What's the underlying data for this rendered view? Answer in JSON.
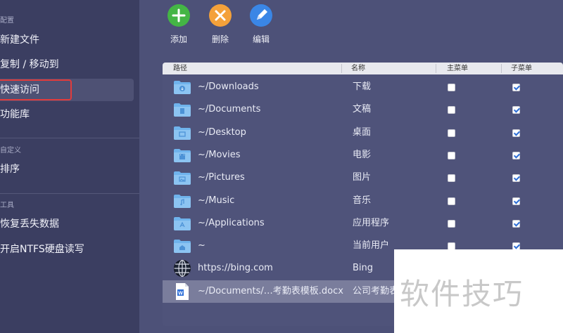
{
  "sidebar": {
    "sections": [
      {
        "label": "配置",
        "items": [
          "新建文件",
          "复制 / 移动到",
          "快速访问",
          "功能库"
        ]
      },
      {
        "label": "自定义",
        "items": [
          "排序"
        ]
      },
      {
        "label": "工具",
        "items": [
          "恢复丢失数据",
          "开启NTFS硬盘读写"
        ]
      }
    ],
    "selected": "快速访问"
  },
  "toolbar": {
    "add_label": "添加",
    "delete_label": "删除",
    "edit_label": "编辑"
  },
  "table": {
    "columns": [
      "路径",
      "名称",
      "主菜单",
      "子菜单"
    ],
    "rows": [
      {
        "icon": "downloads-folder-icon",
        "path": "~/Downloads",
        "name": "下载",
        "main": false,
        "sub": true
      },
      {
        "icon": "documents-folder-icon",
        "path": "~/Documents",
        "name": "文稿",
        "main": false,
        "sub": true
      },
      {
        "icon": "desktop-folder-icon",
        "path": "~/Desktop",
        "name": "桌面",
        "main": false,
        "sub": true
      },
      {
        "icon": "movies-folder-icon",
        "path": "~/Movies",
        "name": "电影",
        "main": false,
        "sub": true
      },
      {
        "icon": "pictures-folder-icon",
        "path": "~/Pictures",
        "name": "图片",
        "main": false,
        "sub": true
      },
      {
        "icon": "music-folder-icon",
        "path": "~/Music",
        "name": "音乐",
        "main": false,
        "sub": true
      },
      {
        "icon": "applications-folder-icon",
        "path": "~/Applications",
        "name": "应用程序",
        "main": false,
        "sub": true
      },
      {
        "icon": "home-folder-icon",
        "path": "~",
        "name": "当前用户",
        "main": false,
        "sub": true
      },
      {
        "icon": "globe-icon",
        "path": "https://bing.com",
        "name": "Bing",
        "main": false,
        "sub": false
      },
      {
        "icon": "word-document-icon",
        "path": "~/Documents/…考勤表模板.docx",
        "name": "公司考勤表",
        "main": false,
        "sub": false
      }
    ],
    "selected_row": 9
  },
  "watermark": {
    "text": "软件技巧"
  },
  "colors": {
    "accent_red": "#e23b3b",
    "add_green": "#44b545",
    "delete_orange": "#f4a13a",
    "edit_blue": "#3a86e6",
    "folder_blue": "#6fb3ec"
  }
}
